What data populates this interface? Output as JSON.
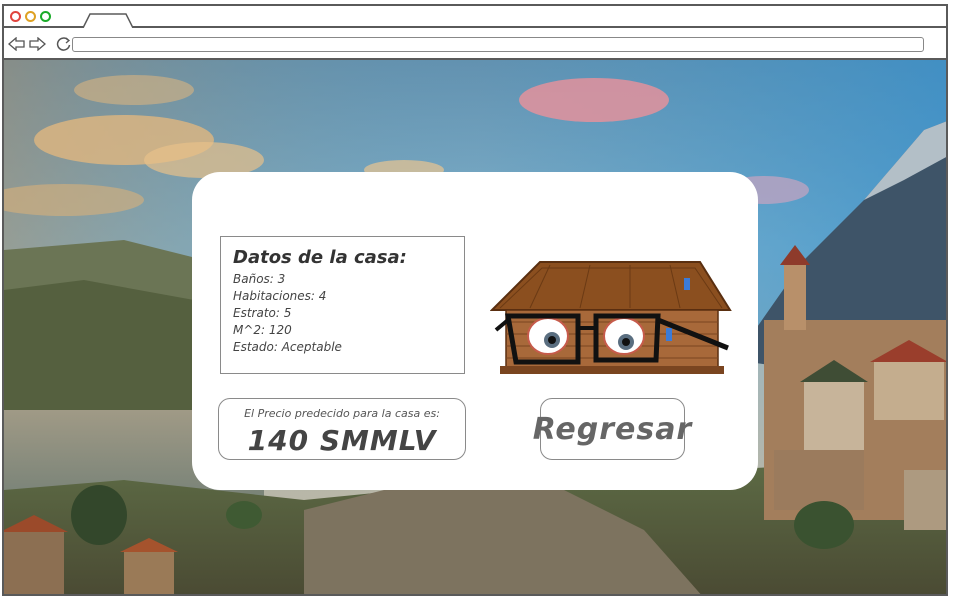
{
  "browser": {
    "url": "",
    "icons": {
      "back": "back-arrow-icon",
      "forward": "forward-arrow-icon",
      "reload": "reload-icon"
    }
  },
  "card": {
    "datos": {
      "title": "Datos de la casa:",
      "rows": [
        "Baños: 3",
        "Habitaciones: 4",
        "Estrato: 5",
        "M^2: 120",
        "Estado: Aceptable"
      ]
    },
    "precio": {
      "label": "El Precio predecido para la casa es:",
      "value": "140 SMMLV"
    },
    "regresar_label": "Regresar"
  },
  "colors": {
    "sky": "#5aa6d3",
    "card_bg": "#ffffff",
    "border": "#8a8a8a"
  }
}
